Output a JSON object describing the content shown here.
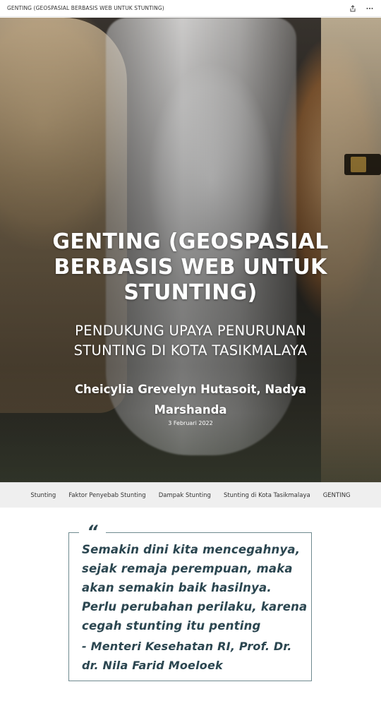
{
  "header": {
    "title": "GENTING (GEOSPASIAL BERBASIS WEB UNTUK STUNTING)",
    "share_icon": "share-icon",
    "more_icon": "more-horizontal-icon"
  },
  "hero": {
    "title": "GENTING (GEOSPASIAL BERBASIS WEB UNTUK STUNTING)",
    "subtitle": "PENDUKUNG UPAYA PENURUNAN STUNTING DI KOTA TASIKMALAYA",
    "authors": "Cheicylia Grevelyn Hutasoit, Nadya Marshanda",
    "date": "3 Februari 2022"
  },
  "nav": {
    "items": [
      {
        "label": "Stunting"
      },
      {
        "label": "Faktor Penyebab Stunting"
      },
      {
        "label": "Dampak Stunting"
      },
      {
        "label": "Stunting di Kota Tasikmalaya"
      },
      {
        "label": "GENTING"
      }
    ]
  },
  "quote": {
    "mark": "“",
    "text": "Semakin dini kita mencegahnya, sejak remaja perempuan, maka akan semakin baik hasilnya. Perlu perubahan perilaku, karena cegah stunting itu penting",
    "author": "- Menteri Kesehatan RI, Prof. Dr. dr. Nila Farid Moeloek"
  },
  "colors": {
    "quote_text": "#2b4650",
    "quote_border": "#6f8a8f",
    "nav_background": "#efefef"
  }
}
